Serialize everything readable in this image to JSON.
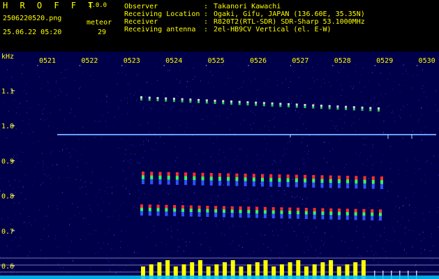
{
  "app": {
    "name": "H R O F F T",
    "version": "1.0.0"
  },
  "file": {
    "name": "2506220520.png",
    "datetime": "25.06.22 05:20"
  },
  "meteor": {
    "label": "meteor",
    "count": "29"
  },
  "station": [
    {
      "label": "Observer",
      "sep": ":",
      "value": "Takanori Kawachi"
    },
    {
      "label": "Receiving Location",
      "sep": ":",
      "value": "Ogaki, Gifu, JAPAN (136.60E, 35.35N)"
    },
    {
      "label": "Receiver",
      "sep": ":",
      "value": "R820T2(RTL-SDR) SDR-Sharp 53.1000MHz"
    },
    {
      "label": "Receiving antenna",
      "sep": ":",
      "value": "2el-HB9CV Vertical (el. E-W)"
    }
  ],
  "spectrogram": {
    "y_unit": "kHz",
    "y_ticks": [
      "1.1",
      "1.0",
      "0.9",
      "0.8",
      "0.7",
      "0.6"
    ],
    "time_ticks": [
      "0521",
      "0522",
      "0523",
      "0524",
      "0525",
      "0526",
      "0527",
      "0528",
      "0529",
      "0530"
    ],
    "colors": {
      "background": "#00004a",
      "noise": "#1a1aa0",
      "carrier": "#4a8cff",
      "echo_head": "#ff3030",
      "echo_mid": "#30ff60",
      "echo_tail": "#3050ff",
      "axis_text": "#ffff00",
      "tick": "#ffffff",
      "activity_bar": "#ffff00",
      "activity_base": "#00c8ff"
    }
  }
}
